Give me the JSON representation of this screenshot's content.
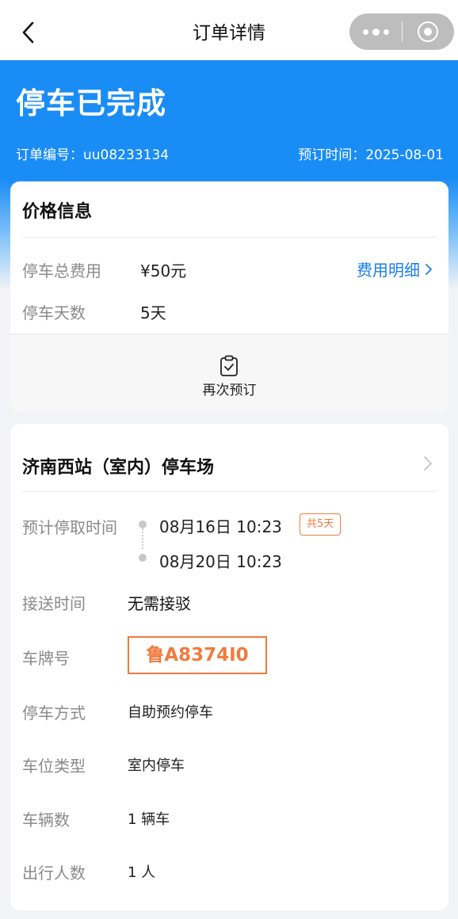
{
  "navbar": {
    "title": "订单详情",
    "back_icon": "chevron-left-icon",
    "capsule_more_icon": "more-dots-icon",
    "capsule_close_icon": "target-close-icon"
  },
  "header": {
    "status": "停车已完成",
    "order_no": "订单编号：uu08233134",
    "booking_time": "预订时间：2025-08-01",
    "color": "#1a8cf5"
  },
  "price_card": {
    "title": "价格信息",
    "total_label": "停车总费用",
    "total_value": "¥50元",
    "detail_link": "费用明细",
    "days_label": "停车天数",
    "days_value": "5天",
    "rebook_label": "再次预订",
    "link_color": "#1a7fe8"
  },
  "parking_card": {
    "lot_name": "济南西站（室内）停车场",
    "time_label": "预计停取时间",
    "start_time": "08月16日 10:23",
    "end_time": "08月20日 10:23",
    "duration_badge": "共5天",
    "shuttle_label": "接送时间",
    "shuttle_value": "无需接驳",
    "plate_label": "车牌号",
    "plate_value": "鲁A8374I0",
    "method_label": "停车方式",
    "method_value": "自助预约停车",
    "space_label": "车位类型",
    "space_value": "室内停车",
    "vehicles_label": "车辆数",
    "vehicles_value": "1 辆车",
    "travelers_label": "出行人数",
    "travelers_value": "1 人",
    "accent_color": "#f07b3f"
  }
}
